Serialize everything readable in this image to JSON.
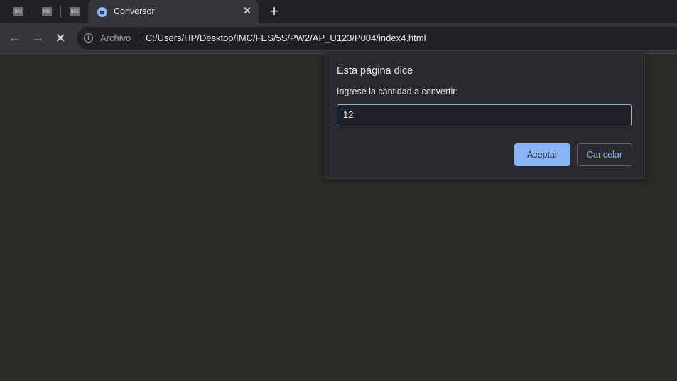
{
  "tabs": {
    "pinned": [
      {
        "icon_text": "001"
      },
      {
        "icon_text": "002"
      },
      {
        "icon_text": "003"
      }
    ],
    "active": {
      "title": "Conversor",
      "close": "✕"
    },
    "new_tab": "+"
  },
  "toolbar": {
    "back": "←",
    "forward": "→",
    "stop": "✕",
    "info_icon": "i",
    "scheme_label": "Archivo",
    "url": "C:/Users/HP/Desktop/IMC/FES/5S/PW2/AP_U123/P004/index4.html"
  },
  "dialog": {
    "title": "Esta página dice",
    "message": "Ingrese la cantidad a convertir:",
    "input_value": "12",
    "ok_label": "Aceptar",
    "cancel_label": "Cancelar"
  },
  "colors": {
    "accent": "#8ab4f8",
    "page_background": "#2b2a27",
    "chrome_dark": "#202124",
    "chrome_toolbar": "#35363a"
  }
}
